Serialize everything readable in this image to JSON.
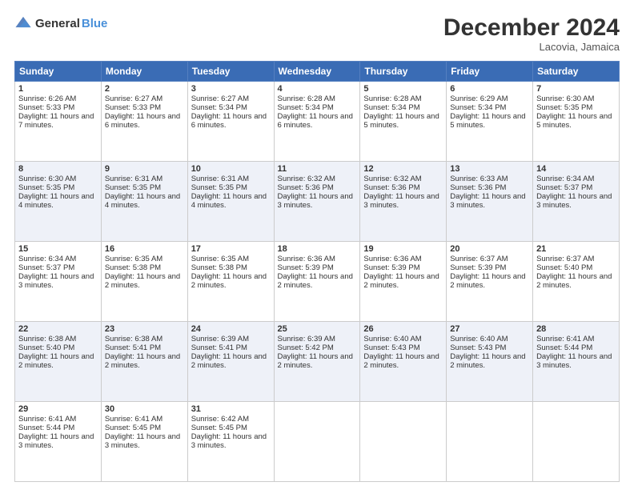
{
  "header": {
    "logo_general": "General",
    "logo_blue": "Blue",
    "month_title": "December 2024",
    "location": "Lacovia, Jamaica"
  },
  "days_of_week": [
    "Sunday",
    "Monday",
    "Tuesday",
    "Wednesday",
    "Thursday",
    "Friday",
    "Saturday"
  ],
  "weeks": [
    [
      {
        "day": "1",
        "sunrise": "6:26 AM",
        "sunset": "5:33 PM",
        "daylight": "11 hours and 7 minutes."
      },
      {
        "day": "2",
        "sunrise": "6:27 AM",
        "sunset": "5:33 PM",
        "daylight": "11 hours and 6 minutes."
      },
      {
        "day": "3",
        "sunrise": "6:27 AM",
        "sunset": "5:34 PM",
        "daylight": "11 hours and 6 minutes."
      },
      {
        "day": "4",
        "sunrise": "6:28 AM",
        "sunset": "5:34 PM",
        "daylight": "11 hours and 6 minutes."
      },
      {
        "day": "5",
        "sunrise": "6:28 AM",
        "sunset": "5:34 PM",
        "daylight": "11 hours and 5 minutes."
      },
      {
        "day": "6",
        "sunrise": "6:29 AM",
        "sunset": "5:34 PM",
        "daylight": "11 hours and 5 minutes."
      },
      {
        "day": "7",
        "sunrise": "6:30 AM",
        "sunset": "5:35 PM",
        "daylight": "11 hours and 5 minutes."
      }
    ],
    [
      {
        "day": "8",
        "sunrise": "6:30 AM",
        "sunset": "5:35 PM",
        "daylight": "11 hours and 4 minutes."
      },
      {
        "day": "9",
        "sunrise": "6:31 AM",
        "sunset": "5:35 PM",
        "daylight": "11 hours and 4 minutes."
      },
      {
        "day": "10",
        "sunrise": "6:31 AM",
        "sunset": "5:35 PM",
        "daylight": "11 hours and 4 minutes."
      },
      {
        "day": "11",
        "sunrise": "6:32 AM",
        "sunset": "5:36 PM",
        "daylight": "11 hours and 3 minutes."
      },
      {
        "day": "12",
        "sunrise": "6:32 AM",
        "sunset": "5:36 PM",
        "daylight": "11 hours and 3 minutes."
      },
      {
        "day": "13",
        "sunrise": "6:33 AM",
        "sunset": "5:36 PM",
        "daylight": "11 hours and 3 minutes."
      },
      {
        "day": "14",
        "sunrise": "6:34 AM",
        "sunset": "5:37 PM",
        "daylight": "11 hours and 3 minutes."
      }
    ],
    [
      {
        "day": "15",
        "sunrise": "6:34 AM",
        "sunset": "5:37 PM",
        "daylight": "11 hours and 3 minutes."
      },
      {
        "day": "16",
        "sunrise": "6:35 AM",
        "sunset": "5:38 PM",
        "daylight": "11 hours and 2 minutes."
      },
      {
        "day": "17",
        "sunrise": "6:35 AM",
        "sunset": "5:38 PM",
        "daylight": "11 hours and 2 minutes."
      },
      {
        "day": "18",
        "sunrise": "6:36 AM",
        "sunset": "5:39 PM",
        "daylight": "11 hours and 2 minutes."
      },
      {
        "day": "19",
        "sunrise": "6:36 AM",
        "sunset": "5:39 PM",
        "daylight": "11 hours and 2 minutes."
      },
      {
        "day": "20",
        "sunrise": "6:37 AM",
        "sunset": "5:39 PM",
        "daylight": "11 hours and 2 minutes."
      },
      {
        "day": "21",
        "sunrise": "6:37 AM",
        "sunset": "5:40 PM",
        "daylight": "11 hours and 2 minutes."
      }
    ],
    [
      {
        "day": "22",
        "sunrise": "6:38 AM",
        "sunset": "5:40 PM",
        "daylight": "11 hours and 2 minutes."
      },
      {
        "day": "23",
        "sunrise": "6:38 AM",
        "sunset": "5:41 PM",
        "daylight": "11 hours and 2 minutes."
      },
      {
        "day": "24",
        "sunrise": "6:39 AM",
        "sunset": "5:41 PM",
        "daylight": "11 hours and 2 minutes."
      },
      {
        "day": "25",
        "sunrise": "6:39 AM",
        "sunset": "5:42 PM",
        "daylight": "11 hours and 2 minutes."
      },
      {
        "day": "26",
        "sunrise": "6:40 AM",
        "sunset": "5:43 PM",
        "daylight": "11 hours and 2 minutes."
      },
      {
        "day": "27",
        "sunrise": "6:40 AM",
        "sunset": "5:43 PM",
        "daylight": "11 hours and 2 minutes."
      },
      {
        "day": "28",
        "sunrise": "6:41 AM",
        "sunset": "5:44 PM",
        "daylight": "11 hours and 3 minutes."
      }
    ],
    [
      {
        "day": "29",
        "sunrise": "6:41 AM",
        "sunset": "5:44 PM",
        "daylight": "11 hours and 3 minutes."
      },
      {
        "day": "30",
        "sunrise": "6:41 AM",
        "sunset": "5:45 PM",
        "daylight": "11 hours and 3 minutes."
      },
      {
        "day": "31",
        "sunrise": "6:42 AM",
        "sunset": "5:45 PM",
        "daylight": "11 hours and 3 minutes."
      },
      null,
      null,
      null,
      null
    ]
  ],
  "labels": {
    "sunrise": "Sunrise:",
    "sunset": "Sunset:",
    "daylight": "Daylight:"
  }
}
